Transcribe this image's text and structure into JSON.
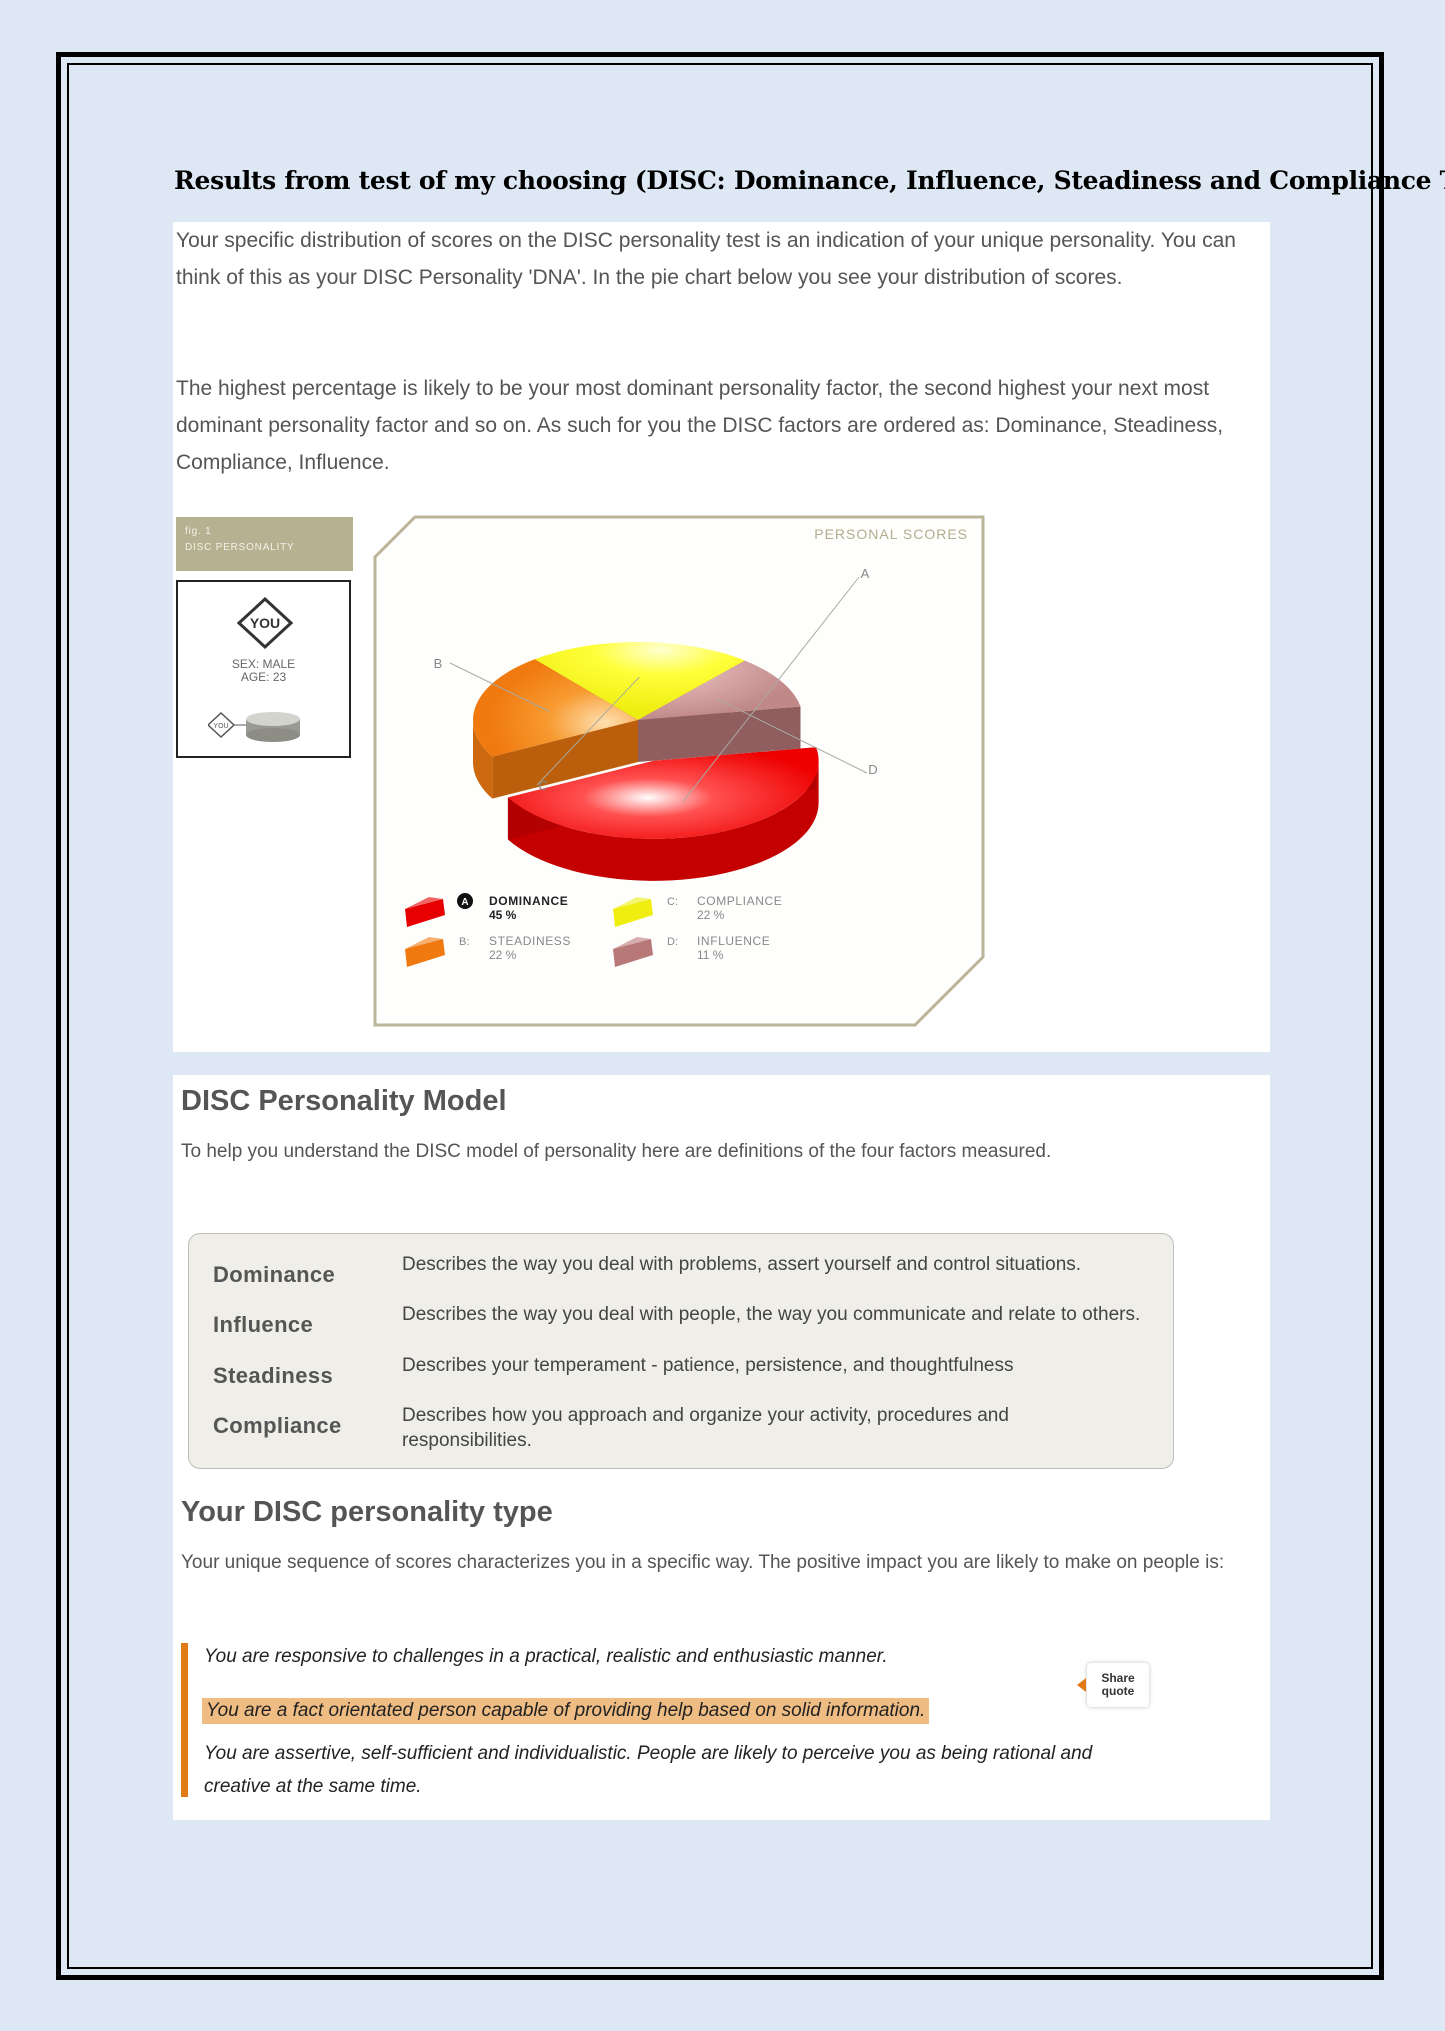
{
  "document": {
    "title": "Results from test of my choosing (DISC: Dominance, Influence, Steadiness and Compliance Test)"
  },
  "intro": {
    "paragraph1": "Your specific distribution of scores on the DISC personality test is an indication of your unique personality. You can think of this as your DISC Personality 'DNA'. In the pie chart below you see your distribution of scores.",
    "paragraph2": "The highest percentage is likely to be your most dominant personality factor, the second highest your next most dominant personality factor and so on. As such for you the DISC factors are ordered as: Dominance, Steadiness, Compliance, Influence."
  },
  "figure": {
    "tag_line1": "fig. 1",
    "tag_line2": "DISC PERSONALITY",
    "you_label": "YOU",
    "sex": "SEX: MALE",
    "age": "AGE: 23",
    "mini_you_label": "YOU",
    "panel_title": "PERSONAL SCORES"
  },
  "chart_data": {
    "type": "pie",
    "title": "PERSONAL SCORES",
    "slices": [
      {
        "letter": "A",
        "name": "DOMINANCE",
        "value": 45,
        "label": "45 %",
        "color": "#e60000"
      },
      {
        "letter": "B",
        "name": "STEADINESS",
        "value": 22,
        "label": "22 %",
        "color": "#f07a10"
      },
      {
        "letter": "C",
        "name": "COMPLIANCE",
        "value": 22,
        "label": "22 %",
        "color": "#f0ee10"
      },
      {
        "letter": "D",
        "name": "INFLUENCE",
        "value": 11,
        "label": "11 %",
        "color": "#b97878"
      }
    ],
    "legend_keys": [
      "A",
      "B:",
      "C:",
      "D:"
    ]
  },
  "model": {
    "heading": "DISC Personality Model",
    "intro": "To help you understand the DISC model of personality here are definitions of the four factors measured.",
    "definitions": [
      {
        "term": "Dominance",
        "desc": "Describes the way you deal with problems, assert yourself and control situations."
      },
      {
        "term": "Influence",
        "desc": "Describes the way you deal with people, the way you communicate and relate to others."
      },
      {
        "term": "Steadiness",
        "desc": "Describes your temperament - patience, persistence, and thoughtfulness"
      },
      {
        "term": "Compliance",
        "desc": "Describes how you approach and organize your activity, procedures and responsibilities."
      }
    ]
  },
  "type": {
    "heading": "Your DISC personality type",
    "intro": "Your unique sequence of scores characterizes you in a specific way. The positive impact you are likely to make on people is:",
    "quote1": "You are responsive to challenges in a practical, realistic and enthusiastic manner.",
    "quote2": "You are a fact orientated person capable of providing help based on solid information.",
    "quote3": "You are assertive, self-sufficient and individualistic. People are likely to perceive you as being rational and creative at the same time.",
    "share_line1": "Share",
    "share_line2": "quote"
  }
}
